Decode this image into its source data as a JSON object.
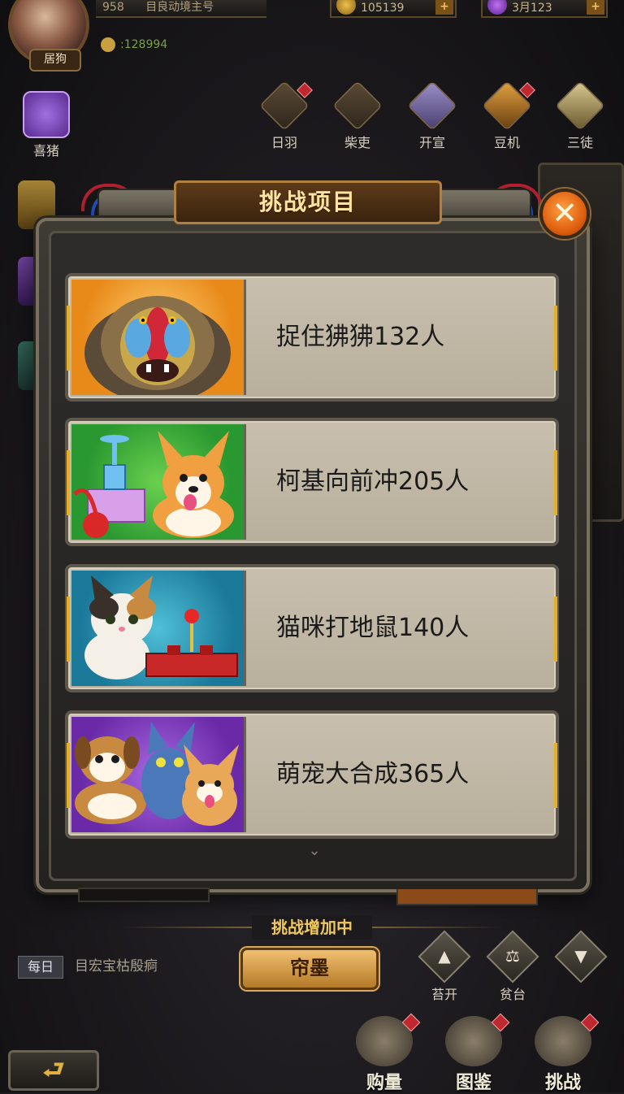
{
  "top": {
    "avatar_label": "居狗",
    "player_info": [
      "958",
      "目良动境主号"
    ],
    "power_value": ":128994",
    "gold": "105139",
    "gems": "3月123"
  },
  "features": [
    {
      "label": "日羽",
      "name": "feature-riyu"
    },
    {
      "label": "柴吏",
      "name": "feature-chaili"
    },
    {
      "label": "开宣",
      "name": "feature-kaixuan"
    },
    {
      "label": "豆机",
      "name": "feature-douji"
    },
    {
      "label": "三徒",
      "name": "feature-santu"
    }
  ],
  "left_icon_label": "喜猪",
  "modal": {
    "title": "挑战项目",
    "close_glyph": "✕",
    "more_glyph": "⌄",
    "items": [
      {
        "label": "捉住狒狒132人",
        "icon": "mandrill-icon",
        "bg": "#e88a1a"
      },
      {
        "label": "柯基向前冲205人",
        "icon": "corgi-icon",
        "bg": "#3aa838"
      },
      {
        "label": "猫咪打地鼠140人",
        "icon": "cat-icon",
        "bg": "#2a8ea8"
      },
      {
        "label": "萌宠大合成365人",
        "icon": "pets-icon",
        "bg": "#7a3ab0"
      }
    ]
  },
  "bottom": {
    "status": "挑战增加中",
    "daily_tag": "每日",
    "daily_text": "目宏宝枯殷痾",
    "action_label": "帘墨",
    "up_label": "苔开",
    "mid_label": "贫台",
    "back_glyph": "⮐",
    "nav": [
      {
        "label": "购量",
        "name": "nav-goumai"
      },
      {
        "label": "图鉴",
        "name": "nav-tujian"
      },
      {
        "label": "挑战",
        "name": "nav-tiaozhan"
      }
    ]
  },
  "colors": {
    "title_text": "#ffe3a0",
    "close_orange": "#e06010",
    "card_bg": "#c8bfae",
    "status_gold": "#f0c860"
  }
}
